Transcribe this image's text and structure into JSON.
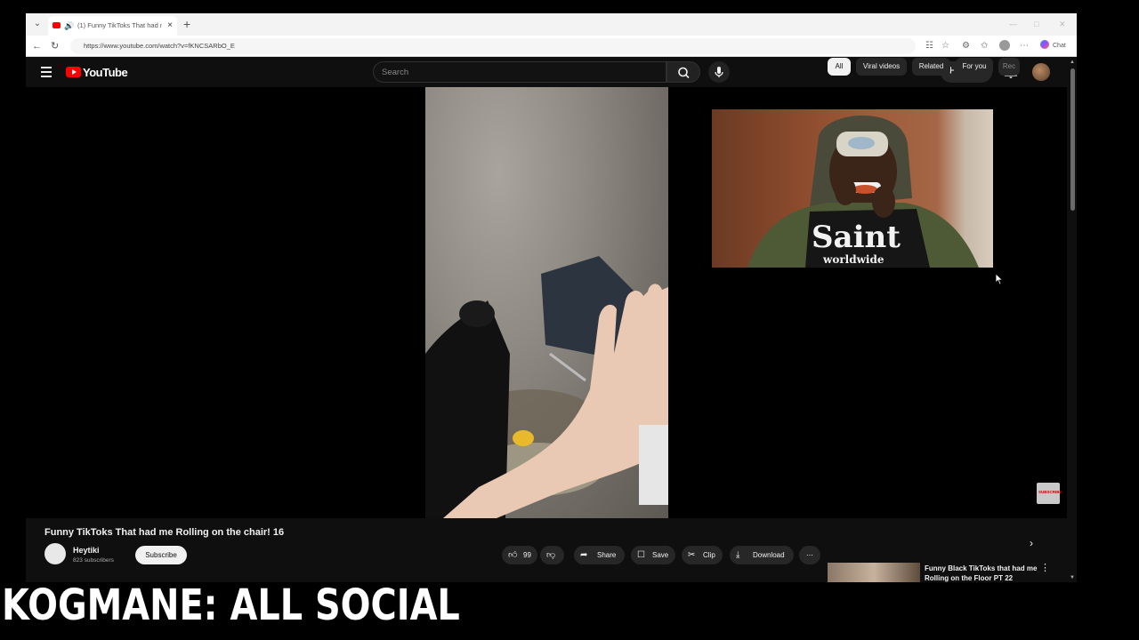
{
  "browser": {
    "tab_title": "(1) Funny TikToks That had me Rolling on the chair! 16",
    "url": "https://www.youtube.com/watch?v=fKNCSARbO_E",
    "chat_label": "Chat"
  },
  "youtube": {
    "logo_text": "YouTube",
    "search_placeholder": "Search",
    "create_label": "Create",
    "notification_count": "1"
  },
  "video": {
    "title": "Funny TikToks That had me Rolling on the chair! 16",
    "channel_name": "Heytiki",
    "channel_subs": "823 subscribers",
    "subscribe_label": "Subscribe",
    "like_count": "99",
    "share_label": "Share",
    "save_label": "Save",
    "clip_label": "Clip",
    "download_label": "Download",
    "pip_shirt_text": "Saint",
    "pip_shirt_subtext": "worldwide",
    "subscribe_watermark": "SUBSCRIBE"
  },
  "chips": [
    "All",
    "Viral videos",
    "Related",
    "For you",
    "Rec"
  ],
  "recommended": {
    "title": "Funny Black TikToks that had me Rolling on the Floor PT 22"
  },
  "overlay_caption": "KOGMANE: ALL SOCIAL"
}
